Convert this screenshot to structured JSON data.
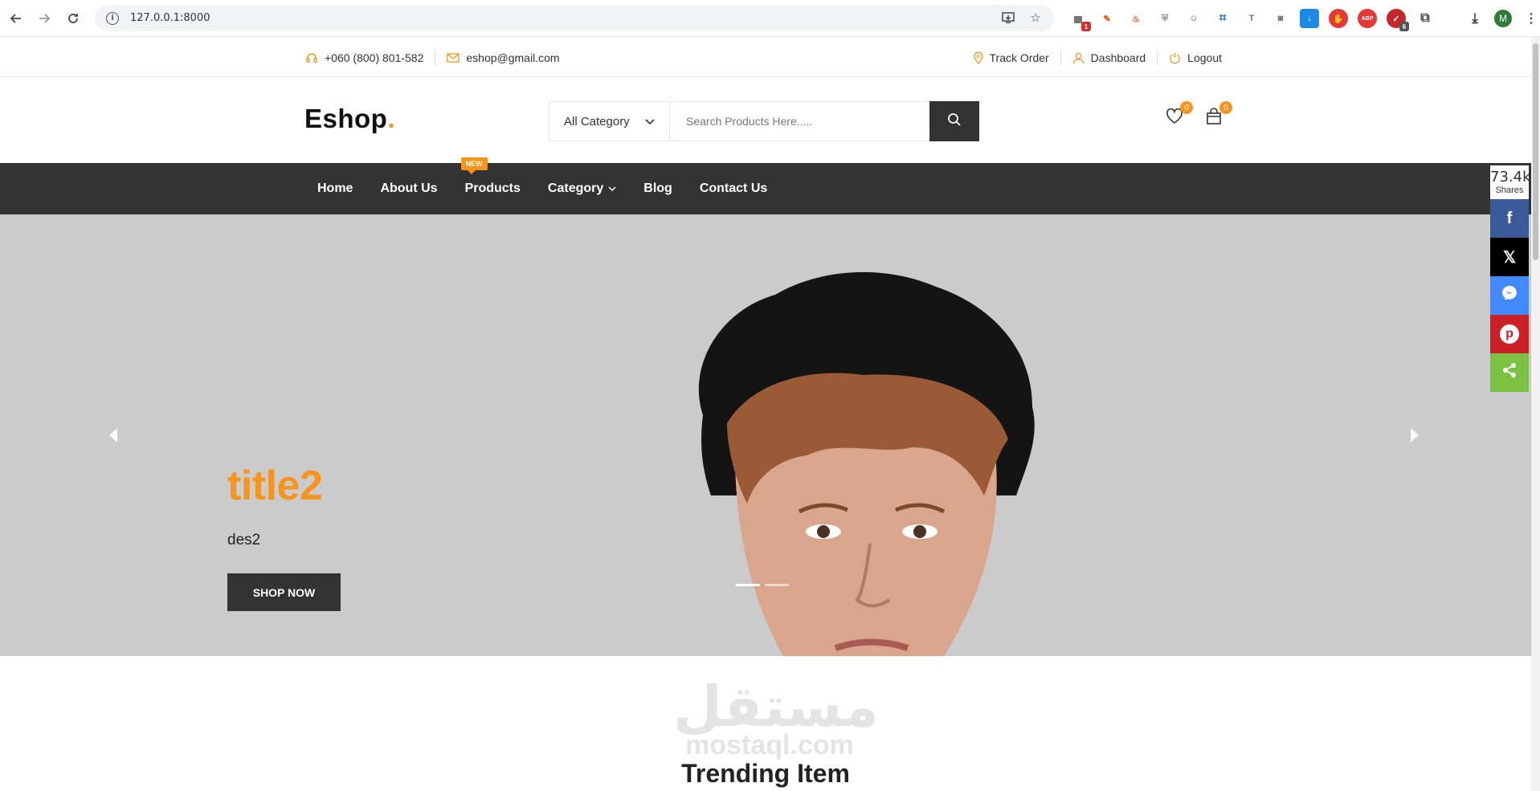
{
  "browser": {
    "url": "127.0.0.1:8000",
    "profile_initial": "M",
    "ext_badges": [
      "1",
      "6"
    ]
  },
  "topbar": {
    "phone": "+060 (800) 801-582",
    "email": "eshop@gmail.com",
    "track_order": "Track Order",
    "dashboard": "Dashboard",
    "logout": "Logout"
  },
  "header": {
    "logo": "Eshop",
    "logo_dot": ".",
    "category_select": "All Category",
    "search_placeholder": "Search Products Here.....",
    "wishlist_count": "0",
    "cart_count": "0"
  },
  "nav": {
    "items": [
      "Home",
      "About Us",
      "Products",
      "Category",
      "Blog",
      "Contact Us"
    ],
    "new_badge": "NEW"
  },
  "hero": {
    "title": "title2",
    "description": "des2",
    "button": "SHOP NOW"
  },
  "share": {
    "count": "73.4k",
    "label": "Shares"
  },
  "watermark": {
    "arabic": "مستقل",
    "latin": "mostaql.com"
  },
  "section": {
    "title": "Trending Item"
  },
  "colors": {
    "accent": "#f7941d",
    "dark": "#333333",
    "hero_bg": "#cbcbcb"
  }
}
